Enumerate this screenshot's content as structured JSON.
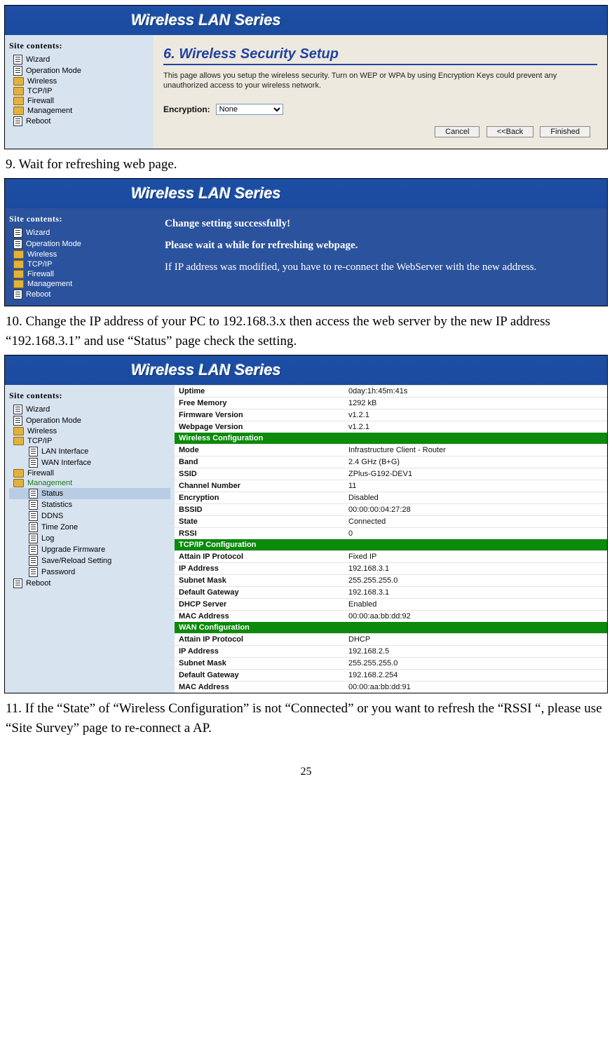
{
  "banner": "Wireless LAN Series",
  "sidebar_title": "Site contents:",
  "sidebar_items": [
    "Wizard",
    "Operation Mode",
    "Wireless",
    "TCP/IP",
    "Firewall",
    "Management",
    "Reboot"
  ],
  "fig1": {
    "title": "6. Wireless Security Setup",
    "desc": "This page allows you setup the wireless security. Turn on WEP or WPA by using Encryption Keys could prevent any unauthorized access to your wireless network.",
    "enc_label": "Encryption:",
    "enc_value": "None",
    "buttons": {
      "cancel": "Cancel",
      "back": "<<Back",
      "finished": "Finished"
    }
  },
  "step9": "9. Wait for refreshing web page.",
  "fig2": {
    "line1": "Change setting successfully!",
    "line2": "Please wait a while for refreshing webpage.",
    "line3": "If IP address was modified, you have to re-connect the WebServer with the new address."
  },
  "step10": "10. Change the IP address of your PC to 192.168.3.x then access the web server by the new IP address “192.168.3.1” and use “Status” page check the setting.",
  "fig3": {
    "sidebar": [
      "Wizard",
      "Operation Mode",
      "Wireless",
      "TCP/IP",
      "LAN Interface",
      "WAN Interface",
      "Firewall",
      "Management",
      "Status",
      "Statistics",
      "DDNS",
      "Time Zone",
      "Log",
      "Upgrade Firmware",
      "Save/Reload Setting",
      "Password",
      "Reboot"
    ],
    "top": [
      {
        "k": "Uptime",
        "v": "0day:1h:45m:41s"
      },
      {
        "k": "Free Memory",
        "v": "1292 kB"
      },
      {
        "k": "Firmware Version",
        "v": "v1.2.1"
      },
      {
        "k": "Webpage Version",
        "v": "v1.2.1"
      }
    ],
    "sect_wireless": "Wireless Configuration",
    "wireless": [
      {
        "k": "Mode",
        "v": "Infrastructure Client - Router"
      },
      {
        "k": "Band",
        "v": "2.4 GHz (B+G)"
      },
      {
        "k": "SSID",
        "v": "ZPlus-G192-DEV1"
      },
      {
        "k": "Channel Number",
        "v": "11"
      },
      {
        "k": "Encryption",
        "v": "Disabled"
      },
      {
        "k": "BSSID",
        "v": "00:00:00:04:27:28"
      },
      {
        "k": "State",
        "v": "Connected"
      },
      {
        "k": "RSSI",
        "v": "0"
      }
    ],
    "sect_tcpip": "TCP/IP Configuration",
    "tcpip": [
      {
        "k": "Attain IP Protocol",
        "v": "Fixed IP"
      },
      {
        "k": "IP Address",
        "v": "192.168.3.1"
      },
      {
        "k": "Subnet Mask",
        "v": "255.255.255.0"
      },
      {
        "k": "Default Gateway",
        "v": "192.168.3.1"
      },
      {
        "k": "DHCP Server",
        "v": "Enabled"
      },
      {
        "k": "MAC Address",
        "v": "00:00:aa:bb:dd:92"
      }
    ],
    "sect_wan": "WAN Configuration",
    "wan": [
      {
        "k": "Attain IP Protocol",
        "v": "DHCP"
      },
      {
        "k": "IP Address",
        "v": "192.168.2.5"
      },
      {
        "k": "Subnet Mask",
        "v": "255.255.255.0"
      },
      {
        "k": "Default Gateway",
        "v": "192.168.2.254"
      },
      {
        "k": "MAC Address",
        "v": "00:00:aa:bb:dd:91"
      }
    ]
  },
  "step11": "11. If the “State” of “Wireless Configuration” is not “Connected” or you want to refresh the “RSSI “, please use “Site Survey” page to re-connect a AP.",
  "page_number": "25"
}
